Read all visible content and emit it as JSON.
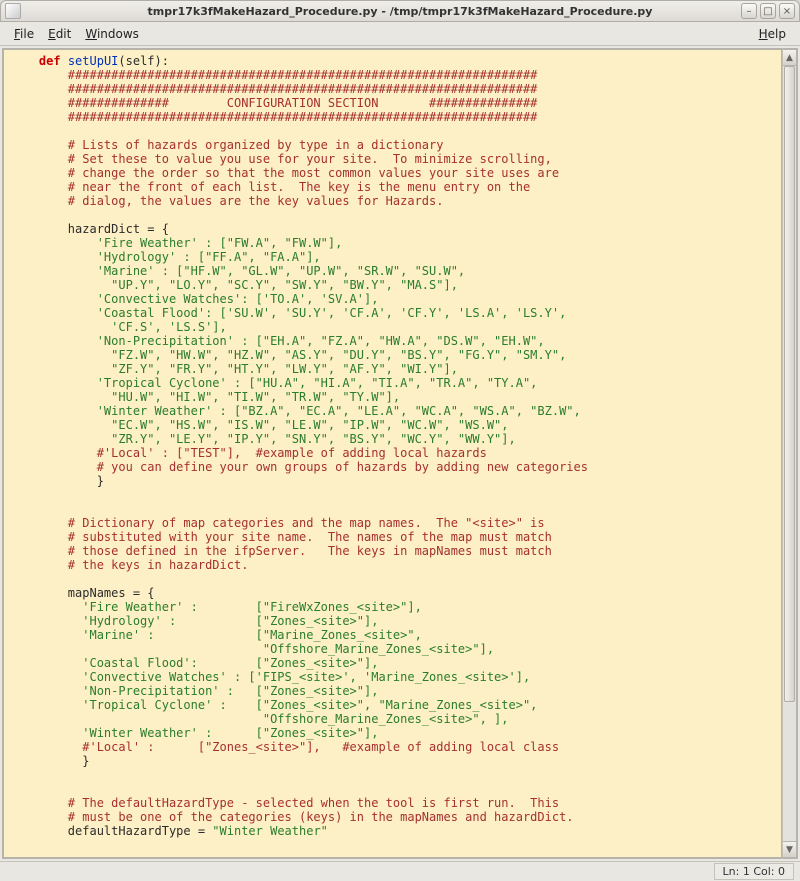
{
  "window": {
    "title": "tmpr17k3fMakeHazard_Procedure.py - /tmp/tmpr17k3fMakeHazard_Procedure.py"
  },
  "menubar": {
    "file": {
      "text": "File",
      "ul": 0
    },
    "edit": {
      "text": "Edit",
      "ul": 0
    },
    "windows": {
      "text": "Windows",
      "ul": 0
    },
    "help": {
      "text": "Help",
      "ul": 0
    }
  },
  "status": {
    "text": "Ln: 1 Col: 0"
  },
  "code": {
    "kw_def": "def",
    "fn_name": "setUpUI",
    "fn_sig_tail": "(self):",
    "banner1": "        #################################################################",
    "banner2": "        #################################################################",
    "banner3": "        ##############        CONFIGURATION SECTION       ###############",
    "banner4": "        #################################################################",
    "cmt_ha1": "        # Lists of hazards organized by type in a dictionary",
    "cmt_ha2": "        # Set these to value you use for your site.  To minimize scrolling,",
    "cmt_ha3": "        # change the order so that the most common values your site uses are",
    "cmt_ha4": "        # near the front of each list.  The key is the menu entry on the",
    "cmt_ha5": "        # dialog, the values are the key values for Hazards.",
    "hd_open": "        hazardDict = {",
    "hd_fire": "            'Fire Weather' : [\"FW.A\", \"FW.W\"],",
    "hd_hydro": "            'Hydrology' : [\"FF.A\", \"FA.A\"],",
    "hd_marine1": "            'Marine' : [\"HF.W\", \"GL.W\", \"UP.W\", \"SR.W\", \"SU.W\",",
    "hd_marine2": "              \"UP.Y\", \"LO.Y\", \"SC.Y\", \"SW.Y\", \"BW.Y\", \"MA.S\"],",
    "hd_conv": "            'Convective Watches': ['TO.A', 'SV.A'],",
    "hd_coast1": "            'Coastal Flood': ['SU.W', 'SU.Y', 'CF.A', 'CF.Y', 'LS.A', 'LS.Y',",
    "hd_coast2": "              'CF.S', 'LS.S'],",
    "hd_np1": "            'Non-Precipitation' : [\"EH.A\", \"FZ.A\", \"HW.A\", \"DS.W\", \"EH.W\",",
    "hd_np2": "              \"FZ.W\", \"HW.W\", \"HZ.W\", \"AS.Y\", \"DU.Y\", \"BS.Y\", \"FG.Y\", \"SM.Y\",",
    "hd_np3": "              \"ZF.Y\", \"FR.Y\", \"HT.Y\", \"LW.Y\", \"AF.Y\", \"WI.Y\"],",
    "hd_tc1": "            'Tropical Cyclone' : [\"HU.A\", \"HI.A\", \"TI.A\", \"TR.A\", \"TY.A\",",
    "hd_tc2": "              \"HU.W\", \"HI.W\", \"TI.W\", \"TR.W\", \"TY.W\"],",
    "hd_ww1": "            'Winter Weather' : [\"BZ.A\", \"EC.A\", \"LE.A\", \"WC.A\", \"WS.A\", \"BZ.W\",",
    "hd_ww2": "              \"EC.W\", \"HS.W\", \"IS.W\", \"LE.W\", \"IP.W\", \"WC.W\", \"WS.W\",",
    "hd_ww3": "              \"ZR.Y\", \"LE.Y\", \"IP.Y\", \"SN.Y\", \"BS.Y\", \"WC.Y\", \"WW.Y\"],",
    "hd_local": "            #'Local' : [\"TEST\"],  #example of adding local hazards",
    "hd_local2": "            # you can define your own groups of hazards by adding new categories",
    "hd_close": "            }",
    "cmt_mn1": "        # Dictionary of map categories and the map names.  The \"<site>\" is",
    "cmt_mn2": "        # substituted with your site name.  The names of the map must match",
    "cmt_mn3": "        # those defined in the ifpServer.   The keys in mapNames must match",
    "cmt_mn4": "        # the keys in hazardDict.",
    "mn_open": "        mapNames = {",
    "mn_fire": "          'Fire Weather' :        [\"FireWxZones_<site>\"],",
    "mn_hydro": "          'Hydrology' :           [\"Zones_<site>\"],",
    "mn_marine1": "          'Marine' :              [\"Marine_Zones_<site>\",",
    "mn_marine2": "                                   \"Offshore_Marine_Zones_<site>\"],",
    "mn_coast": "          'Coastal Flood':        [\"Zones_<site>\"],",
    "mn_conv": "          'Convective Watches' : ['FIPS_<site>', 'Marine_Zones_<site>'],",
    "mn_np": "          'Non-Precipitation' :   [\"Zones_<site>\"],",
    "mn_tc1": "          'Tropical Cyclone' :    [\"Zones_<site>\", \"Marine_Zones_<site>\",",
    "mn_tc2": "                                   \"Offshore_Marine_Zones_<site>\", ],",
    "mn_ww": "          'Winter Weather' :      [\"Zones_<site>\"],",
    "mn_local": "          #'Local' :      [\"Zones_<site>\"],   #example of adding local class",
    "mn_close": "          }",
    "cmt_def1": "        # The defaultHazardType - selected when the tool is first run.  This",
    "cmt_def2": "        # must be one of the categories (keys) in the mapNames and hazardDict.",
    "def_line_pl": "        defaultHazardType = ",
    "def_line_str": "\"Winter Weather\""
  }
}
